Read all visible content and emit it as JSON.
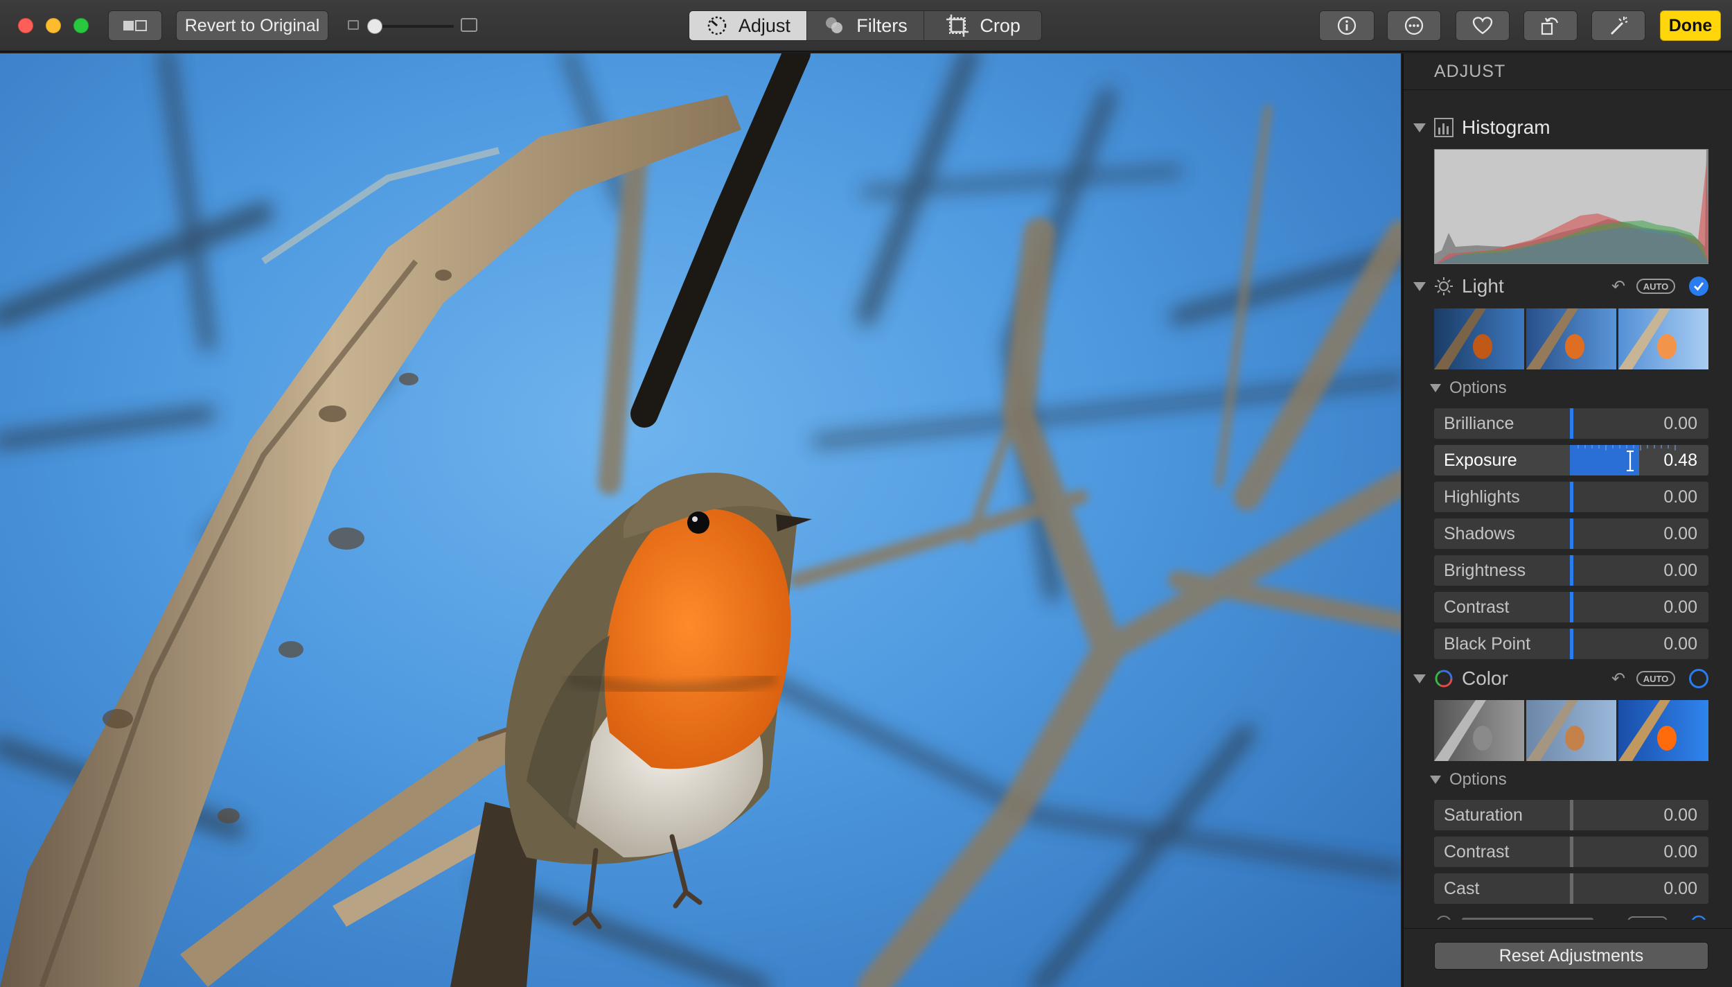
{
  "toolbar": {
    "revert_label": "Revert to Original",
    "tabs": [
      {
        "label": "Adjust",
        "active": true
      },
      {
        "label": "Filters",
        "active": false
      },
      {
        "label": "Crop",
        "active": false
      }
    ],
    "done_label": "Done",
    "zoom_level": 0.0
  },
  "sidebar": {
    "header": "ADJUST",
    "histogram": {
      "title": "Histogram"
    },
    "light": {
      "title": "Light",
      "auto_label": "AUTO",
      "enabled": true,
      "options_label": "Options",
      "sliders": [
        {
          "label": "Brilliance",
          "value": "0.00"
        },
        {
          "label": "Exposure",
          "value": "0.48"
        },
        {
          "label": "Highlights",
          "value": "0.00"
        },
        {
          "label": "Shadows",
          "value": "0.00"
        },
        {
          "label": "Brightness",
          "value": "0.00"
        },
        {
          "label": "Contrast",
          "value": "0.00"
        },
        {
          "label": "Black Point",
          "value": "0.00"
        }
      ]
    },
    "color": {
      "title": "Color",
      "auto_label": "AUTO",
      "enabled": false,
      "options_label": "Options",
      "sliders": [
        {
          "label": "Saturation",
          "value": "0.00"
        },
        {
          "label": "Contrast",
          "value": "0.00"
        },
        {
          "label": "Cast",
          "value": "0.00"
        }
      ]
    },
    "reset_label": "Reset Adjustments"
  },
  "colors": {
    "accent": "#2a7df0",
    "done_button": "#ffd60a",
    "sky": "#4d98df",
    "robin_breast": "#f07a1a"
  },
  "icons": [
    "compare-icon",
    "info-icon",
    "more-icon",
    "heart-icon",
    "rotate-icon",
    "magic-wand-icon",
    "adjust-icon",
    "filters-icon",
    "crop-icon",
    "histogram-icon",
    "sun-icon",
    "color-wheel-icon",
    "undo-icon",
    "checkmark-icon"
  ]
}
